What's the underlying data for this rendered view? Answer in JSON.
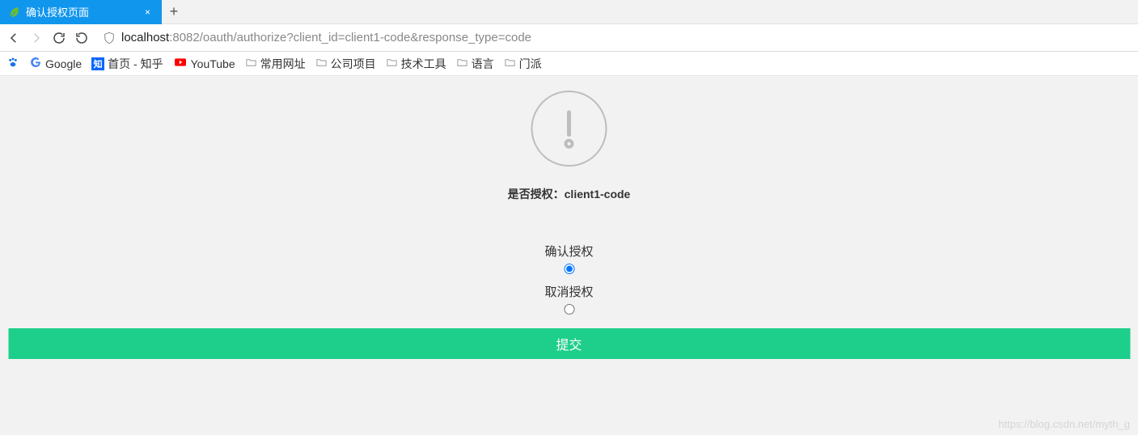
{
  "tab": {
    "title": "确认授权页面",
    "favicon_color": "#6dbf2d"
  },
  "address": {
    "host": "localhost",
    "rest": ":8082/oauth/authorize?client_id=client1-code&response_type=code"
  },
  "bookmarks": {
    "baidu_icon_color": "#1a73e8",
    "google_label": "Google",
    "google_icon_color": "#ea4335",
    "zhihu_label": "首页 - 知乎",
    "zhihu_icon_bg": "#0a66ff",
    "youtube_label": "YouTube",
    "youtube_icon_color": "#ff0000",
    "folders": [
      "常用网址",
      "公司项目",
      "技术工具",
      "语言",
      "门派"
    ]
  },
  "auth": {
    "question_prefix": "是否授权：",
    "client": "client1-code",
    "confirm_label": "确认授权",
    "cancel_label": "取消授权",
    "submit_label": "提交",
    "confirm_checked": true,
    "cancel_checked": false
  },
  "watermark": "https://blog.csdn.net/myth_g"
}
